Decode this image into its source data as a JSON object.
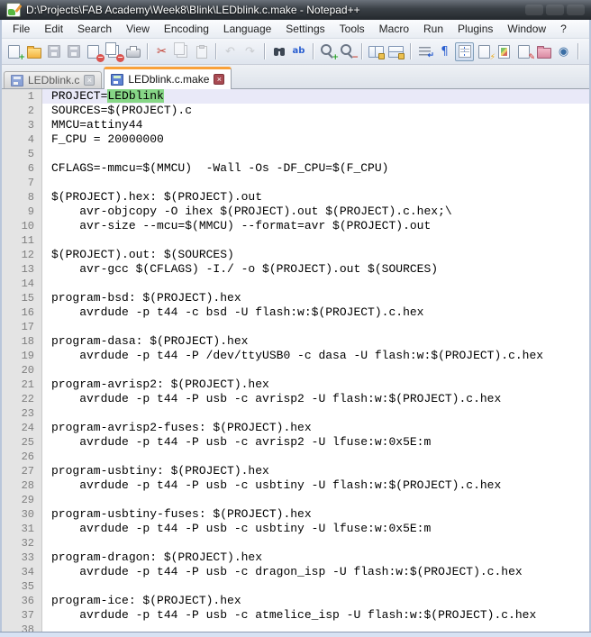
{
  "window": {
    "title": "D:\\Projects\\FAB Academy\\Week8\\Blink\\LEDblink.c.make - Notepad++"
  },
  "colors": {
    "accent_orange": "#F9A13A",
    "highlight_green": "#86D686",
    "current_line": "#E9E9F8",
    "margin_bg": "#E4E4E4",
    "line_number": "#7E7E7E"
  },
  "menu": {
    "items": [
      {
        "id": "file",
        "label": "File"
      },
      {
        "id": "edit",
        "label": "Edit"
      },
      {
        "id": "search",
        "label": "Search"
      },
      {
        "id": "view",
        "label": "View"
      },
      {
        "id": "encoding",
        "label": "Encoding"
      },
      {
        "id": "language",
        "label": "Language"
      },
      {
        "id": "settings",
        "label": "Settings"
      },
      {
        "id": "tools",
        "label": "Tools"
      },
      {
        "id": "macro",
        "label": "Macro"
      },
      {
        "id": "run",
        "label": "Run"
      },
      {
        "id": "plugins",
        "label": "Plugins"
      },
      {
        "id": "window",
        "label": "Window"
      },
      {
        "id": "help",
        "label": "?"
      }
    ]
  },
  "toolbar": {
    "items": [
      {
        "id": "new-file",
        "base": "page",
        "badge": "+",
        "badge_color": "#1f9d1f"
      },
      {
        "id": "open-file",
        "base": "folder"
      },
      {
        "id": "save",
        "base": "floppy",
        "disabled": true
      },
      {
        "id": "save-all",
        "base": "floppy",
        "disabled": true
      },
      {
        "id": "close",
        "base": "page",
        "badge": "−",
        "badge_bg": "#d9534f"
      },
      {
        "id": "close-all",
        "base": "pages",
        "badge": "−",
        "badge_bg": "#d9534f"
      },
      {
        "id": "print",
        "base": "printer"
      },
      {
        "sep": true
      },
      {
        "id": "cut",
        "base": "glyph",
        "glyph": "✂",
        "color": "#c0392b"
      },
      {
        "id": "copy",
        "base": "pages",
        "disabled": true
      },
      {
        "id": "paste",
        "base": "clip",
        "disabled": true
      },
      {
        "sep": true
      },
      {
        "id": "undo",
        "base": "glyph",
        "glyph": "↶",
        "color": "#9aa2ac",
        "disabled": true
      },
      {
        "id": "redo",
        "base": "glyph",
        "glyph": "↷",
        "color": "#9aa2ac",
        "disabled": true
      },
      {
        "sep": true
      },
      {
        "id": "find",
        "base": "binoc"
      },
      {
        "id": "replace",
        "base": "glyph",
        "glyph": "ab",
        "color": "#2a5fd0",
        "small": true
      },
      {
        "sep": true
      },
      {
        "id": "zoom-in",
        "base": "mag",
        "badge": "+",
        "badge_color": "#1f9d1f"
      },
      {
        "id": "zoom-out",
        "base": "mag",
        "badge": "−",
        "badge_color": "#c0392b"
      },
      {
        "sep": true
      },
      {
        "id": "sync-vertical-scroll",
        "base": "panes"
      },
      {
        "id": "sync-horizontal-scroll",
        "base": "panes",
        "variant": "h"
      },
      {
        "sep": true
      },
      {
        "id": "word-wrap",
        "base": "wraplines"
      },
      {
        "id": "show-all-characters",
        "base": "glyph",
        "glyph": "¶",
        "color": "#2a5fd0"
      },
      {
        "id": "show-indent-guide",
        "base": "indent",
        "pressed": true
      },
      {
        "id": "function-list",
        "base": "page",
        "badge": "⚡",
        "badge_color": "#e8a000"
      },
      {
        "id": "document-map",
        "base": "map"
      },
      {
        "id": "document-switcher",
        "base": "page",
        "badge": "✎",
        "badge_color": "#cc2222"
      },
      {
        "id": "project-panel",
        "base": "folder",
        "variant": "pink"
      },
      {
        "id": "document-monitor",
        "base": "glyph",
        "glyph": "◉",
        "color": "#3a6ea5"
      },
      {
        "sep": true
      }
    ]
  },
  "tabs": [
    {
      "id": "ledblink-c",
      "label": "LEDblink.c",
      "close_glyph": "×",
      "active": false
    },
    {
      "id": "ledblink-c-make",
      "label": "LEDblink.c.make",
      "close_glyph": "×",
      "active": true
    }
  ],
  "editor": {
    "current_line": 1,
    "lines": [
      [
        {
          "t": "PROJECT="
        },
        {
          "t": "LEDblink",
          "hl": true
        }
      ],
      "SOURCES=$(PROJECT).c",
      "MMCU=attiny44",
      "F_CPU = 20000000",
      "",
      "CFLAGS=-mmcu=$(MMCU)  -Wall -Os -DF_CPU=$(F_CPU)",
      "",
      "$(PROJECT).hex: $(PROJECT).out",
      "    avr-objcopy -O ihex $(PROJECT).out $(PROJECT).c.hex;\\",
      "    avr-size --mcu=$(MMCU) --format=avr $(PROJECT).out",
      "",
      "$(PROJECT).out: $(SOURCES)",
      "    avr-gcc $(CFLAGS) -I./ -o $(PROJECT).out $(SOURCES)",
      "",
      "program-bsd: $(PROJECT).hex",
      "    avrdude -p t44 -c bsd -U flash:w:$(PROJECT).c.hex",
      "",
      "program-dasa: $(PROJECT).hex",
      "    avrdude -p t44 -P /dev/ttyUSB0 -c dasa -U flash:w:$(PROJECT).c.hex",
      "",
      "program-avrisp2: $(PROJECT).hex",
      "    avrdude -p t44 -P usb -c avrisp2 -U flash:w:$(PROJECT).c.hex",
      "",
      "program-avrisp2-fuses: $(PROJECT).hex",
      "    avrdude -p t44 -P usb -c avrisp2 -U lfuse:w:0x5E:m",
      "",
      "program-usbtiny: $(PROJECT).hex",
      "    avrdude -p t44 -P usb -c usbtiny -U flash:w:$(PROJECT).c.hex",
      "",
      "program-usbtiny-fuses: $(PROJECT).hex",
      "    avrdude -p t44 -P usb -c usbtiny -U lfuse:w:0x5E:m",
      "",
      "program-dragon: $(PROJECT).hex",
      "    avrdude -p t44 -P usb -c dragon_isp -U flash:w:$(PROJECT).c.hex",
      "",
      "program-ice: $(PROJECT).hex",
      "    avrdude -p t44 -P usb -c atmelice_isp -U flash:w:$(PROJECT).c.hex",
      ""
    ]
  }
}
